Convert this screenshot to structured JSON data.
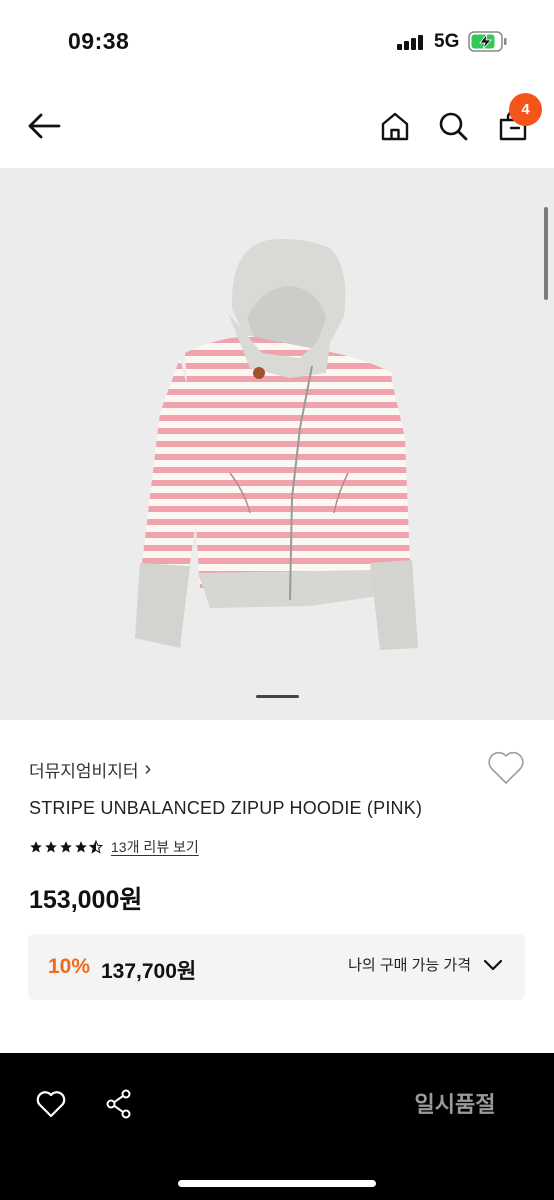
{
  "status_bar": {
    "time": "09:38",
    "network": "5G",
    "icons": [
      "signal-bars-icon",
      "battery-charging-icon"
    ]
  },
  "nav": {
    "icons": [
      "back-arrow-icon",
      "home-icon",
      "search-icon",
      "cart-icon"
    ],
    "cart_count": "4"
  },
  "gallery": {
    "image": "pink-white-striped-zip-hoodie-with-gray-hood",
    "current_page": 1
  },
  "product": {
    "brand": "더뮤지엄비지터",
    "brand_chevron": "›",
    "name": "STRIPE UNBALANCED ZIPUP HOODIE (PINK)",
    "rating": 4.5,
    "review_link": "13개 리뷰 보기",
    "price": "153,000원"
  },
  "discount": {
    "rate": "10%",
    "price": "137,700원",
    "toggle_label": "나의 구매 가능 가격",
    "accent_color": "#f26a1b"
  },
  "bottom_bar": {
    "icons": [
      "heart-outline-icon",
      "share-icon"
    ],
    "sold_out_label": "일시품절"
  },
  "colors": {
    "badge": "#f5541b",
    "bottom_bar_bg": "#000000",
    "gallery_bg": "#ececec"
  }
}
